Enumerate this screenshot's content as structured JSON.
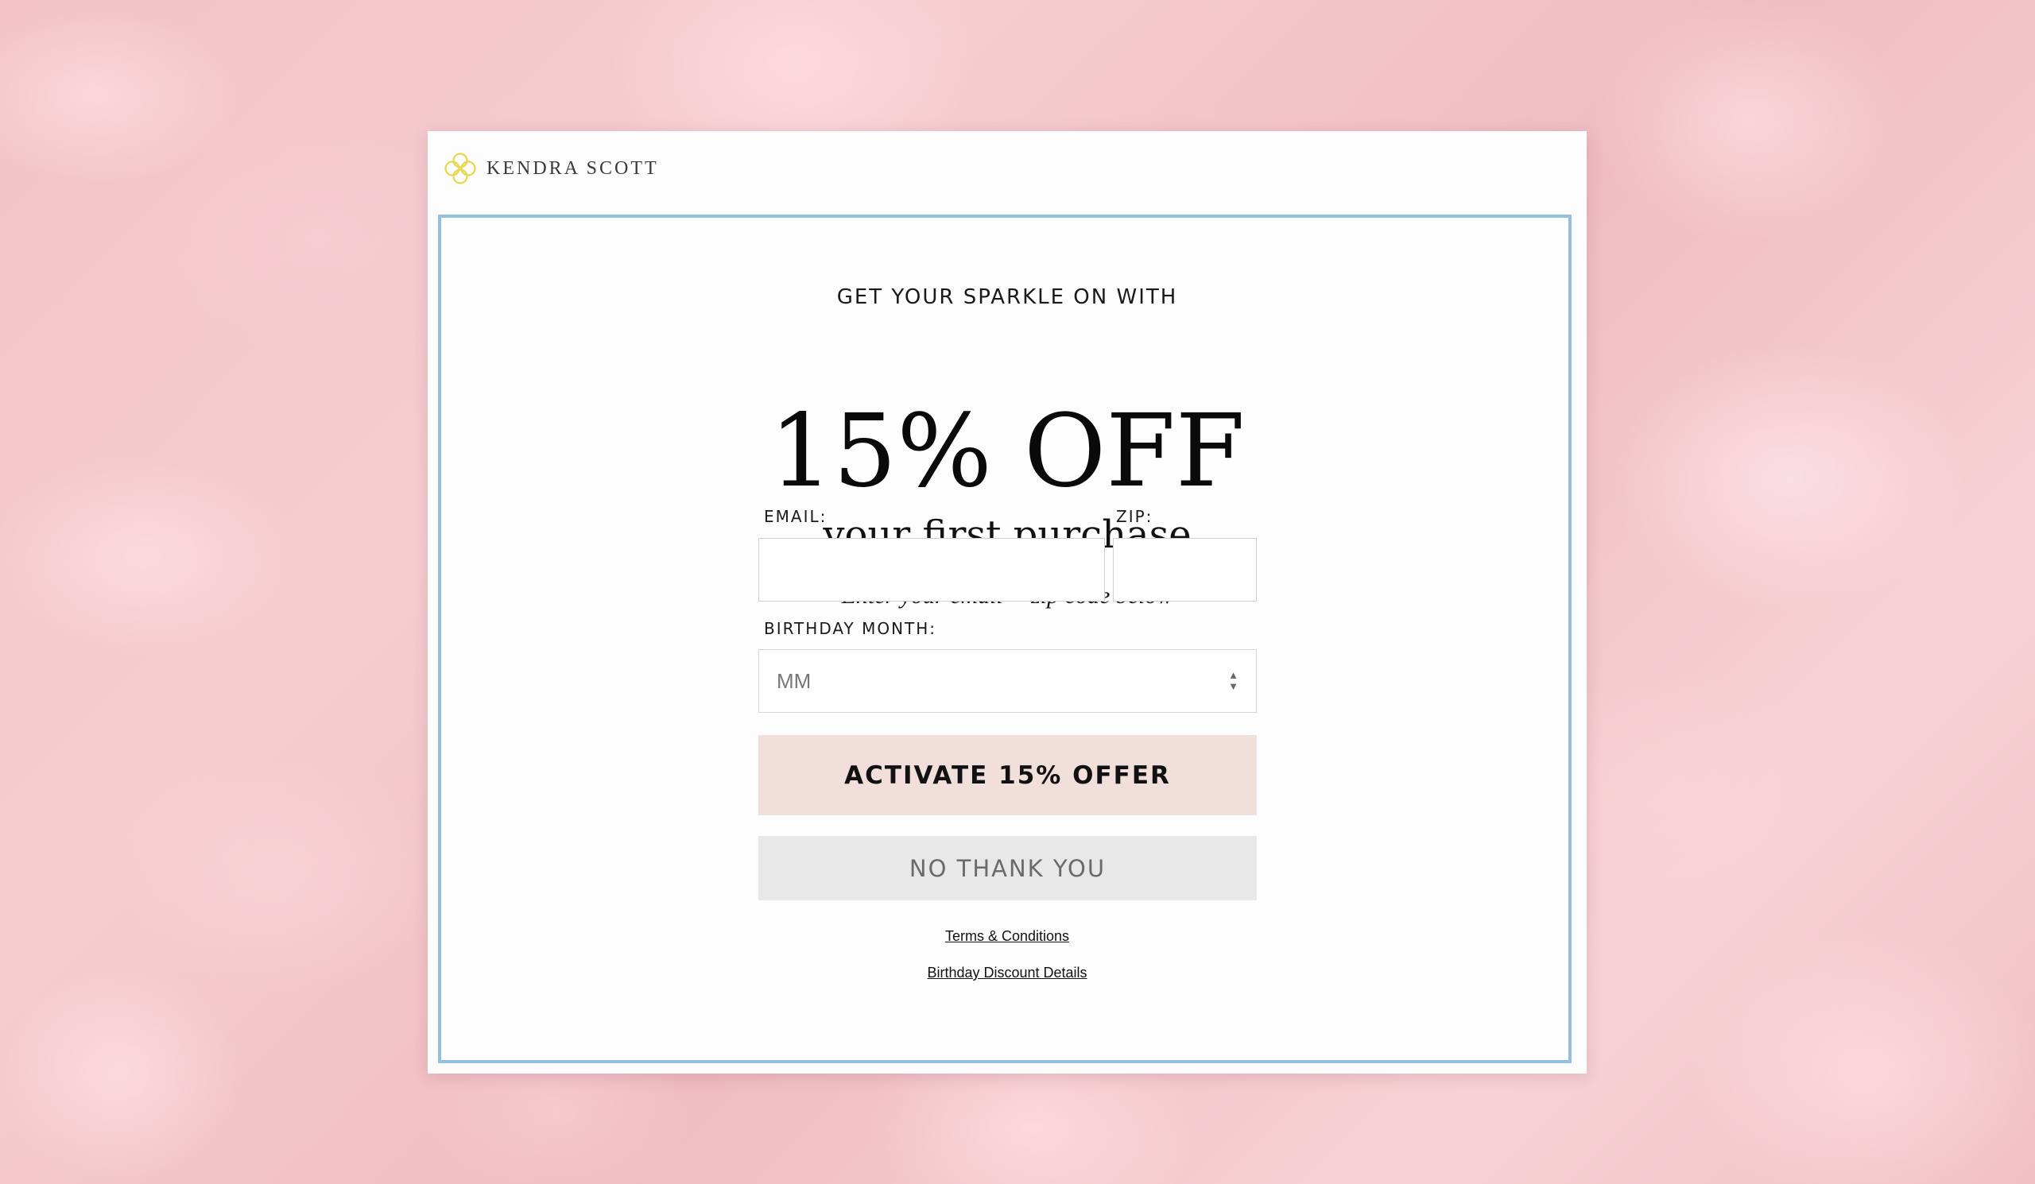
{
  "brand": {
    "name": "KENDRA SCOTT",
    "logo_icon": "kendra-scott-flower-logo",
    "logo_color": "#e8d64a"
  },
  "offer": {
    "eyebrow": "GET YOUR SPARKLE ON WITH",
    "headline": "15% OFF",
    "sub_headline": "your first purchase",
    "instruction": "Enter your email + zip code below"
  },
  "form": {
    "email_label": "EMAIL:",
    "email_value": "",
    "zip_label": "ZIP:",
    "zip_value": "",
    "birthday_label": "BIRTHDAY MONTH:",
    "birthday_selected": "MM"
  },
  "actions": {
    "activate_label": "ACTIVATE 15% OFFER",
    "decline_label": "NO THANK YOU"
  },
  "links": {
    "terms": "Terms & Conditions",
    "birthday_details": "Birthday Discount Details"
  },
  "colors": {
    "frame_border": "#92c0e0",
    "primary_button": "#f1dfdb",
    "secondary_button": "#e8e8e8"
  }
}
